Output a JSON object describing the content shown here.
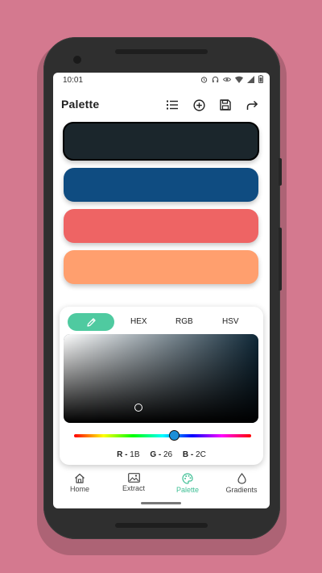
{
  "status_bar": {
    "time": "10:01"
  },
  "header": {
    "title": "Palette"
  },
  "icons": {
    "list": "list-icon",
    "add": "add-circle-icon",
    "save": "save-icon",
    "share": "share-icon"
  },
  "palette": {
    "swatches": [
      {
        "color": "#1b262c",
        "selected": true
      },
      {
        "color": "#0f4c81",
        "selected": false
      },
      {
        "color": "#ee6464",
        "selected": false
      },
      {
        "color": "#ff9f6e",
        "selected": false
      }
    ]
  },
  "picker": {
    "tabs": [
      "HEX",
      "RGB",
      "HSV"
    ],
    "hue_color": "#0f2838",
    "hue_position": 0.56,
    "rgb": {
      "r_label": "R -",
      "r_value": "1B",
      "g_label": "G -",
      "g_value": "26",
      "b_label": "B -",
      "b_value": "2C"
    }
  },
  "nav": {
    "items": [
      {
        "label": "Home"
      },
      {
        "label": "Extract"
      },
      {
        "label": "Palette"
      },
      {
        "label": "Gradients"
      }
    ],
    "active_color": "#3fbf95"
  }
}
